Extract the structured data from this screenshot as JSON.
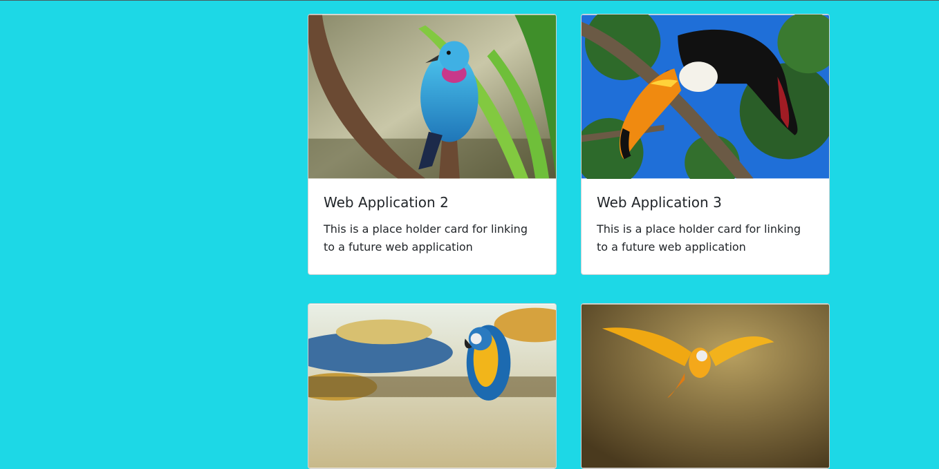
{
  "page": {
    "background": "#1dd8e6"
  },
  "cards": [
    {
      "title": "Web Application 2",
      "text": "This is a place holder card for linking to a future web application",
      "image": "blue-cotinga-bird-image"
    },
    {
      "title": "Web Application 3",
      "text": "This is a place holder card for linking to a future web application",
      "image": "toucan-bird-image"
    },
    {
      "title": "",
      "text": "",
      "image": "blue-gold-macaw-image"
    },
    {
      "title": "",
      "text": "",
      "image": "flying-macaw-image"
    }
  ]
}
